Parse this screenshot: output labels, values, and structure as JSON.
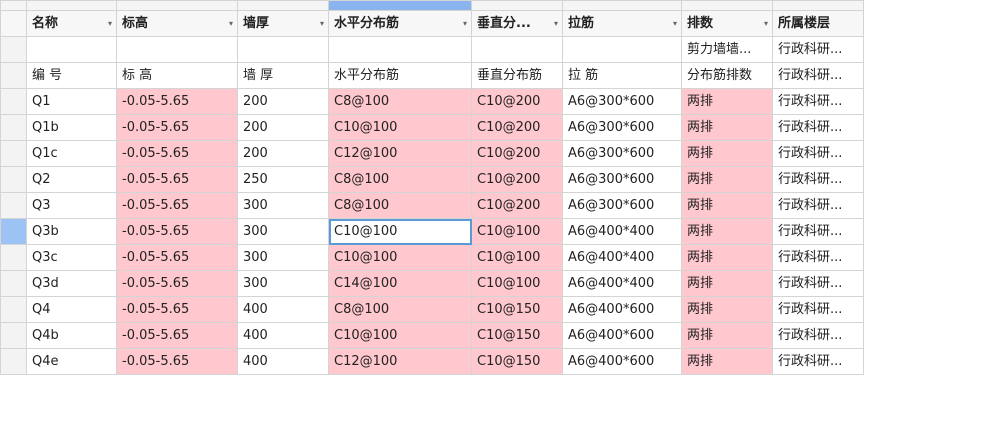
{
  "columns": [
    {
      "label": "名称"
    },
    {
      "label": "标高"
    },
    {
      "label": "墙厚"
    },
    {
      "label": "水平分布筋"
    },
    {
      "label": "垂直分..."
    },
    {
      "label": "拉筋"
    },
    {
      "label": "排数"
    },
    {
      "label": "所属楼层"
    }
  ],
  "filter_glyph": "▾",
  "subheader1": [
    "",
    "",
    "",
    "",
    "",
    "",
    "剪力墙墙...",
    "行政科研..."
  ],
  "subheader2": [
    "编 号",
    "标  高",
    "墙  厚",
    "水平分布筋",
    "垂直分布筋",
    "拉  筋",
    "分布筋排数",
    "行政科研..."
  ],
  "rows": [
    [
      "Q1",
      "-0.05-5.65",
      "200",
      "C8@100",
      "C10@200",
      "A6@300*600",
      "两排",
      "行政科研..."
    ],
    [
      "Q1b",
      "-0.05-5.65",
      "200",
      "C10@100",
      "C10@200",
      "A6@300*600",
      "两排",
      "行政科研..."
    ],
    [
      "Q1c",
      "-0.05-5.65",
      "200",
      "C12@100",
      "C10@200",
      "A6@300*600",
      "两排",
      "行政科研..."
    ],
    [
      "Q2",
      "-0.05-5.65",
      "250",
      "C8@100",
      "C10@200",
      "A6@300*600",
      "两排",
      "行政科研..."
    ],
    [
      "Q3",
      "-0.05-5.65",
      "300",
      "C8@100",
      "C10@200",
      "A6@300*600",
      "两排",
      "行政科研..."
    ],
    [
      "Q3b",
      "-0.05-5.65",
      "300",
      "C10@100",
      "C10@100",
      "A6@400*400",
      "两排",
      "行政科研..."
    ],
    [
      "Q3c",
      "-0.05-5.65",
      "300",
      "C10@100",
      "C10@100",
      "A6@400*400",
      "两排",
      "行政科研..."
    ],
    [
      "Q3d",
      "-0.05-5.65",
      "300",
      "C14@100",
      "C10@100",
      "A6@400*400",
      "两排",
      "行政科研..."
    ],
    [
      "Q4",
      "-0.05-5.65",
      "400",
      "C8@100",
      "C10@150",
      "A6@400*600",
      "两排",
      "行政科研..."
    ],
    [
      "Q4b",
      "-0.05-5.65",
      "400",
      "C10@100",
      "C10@150",
      "A6@400*600",
      "两排",
      "行政科研..."
    ],
    [
      "Q4e",
      "-0.05-5.65",
      "400",
      "C12@100",
      "C10@150",
      "A6@400*600",
      "两排",
      "行政科研..."
    ]
  ],
  "highlight_color": "#ffc7ce",
  "pink_columns": [
    1,
    3,
    4,
    6
  ],
  "active_row": 5,
  "active_col": 3
}
